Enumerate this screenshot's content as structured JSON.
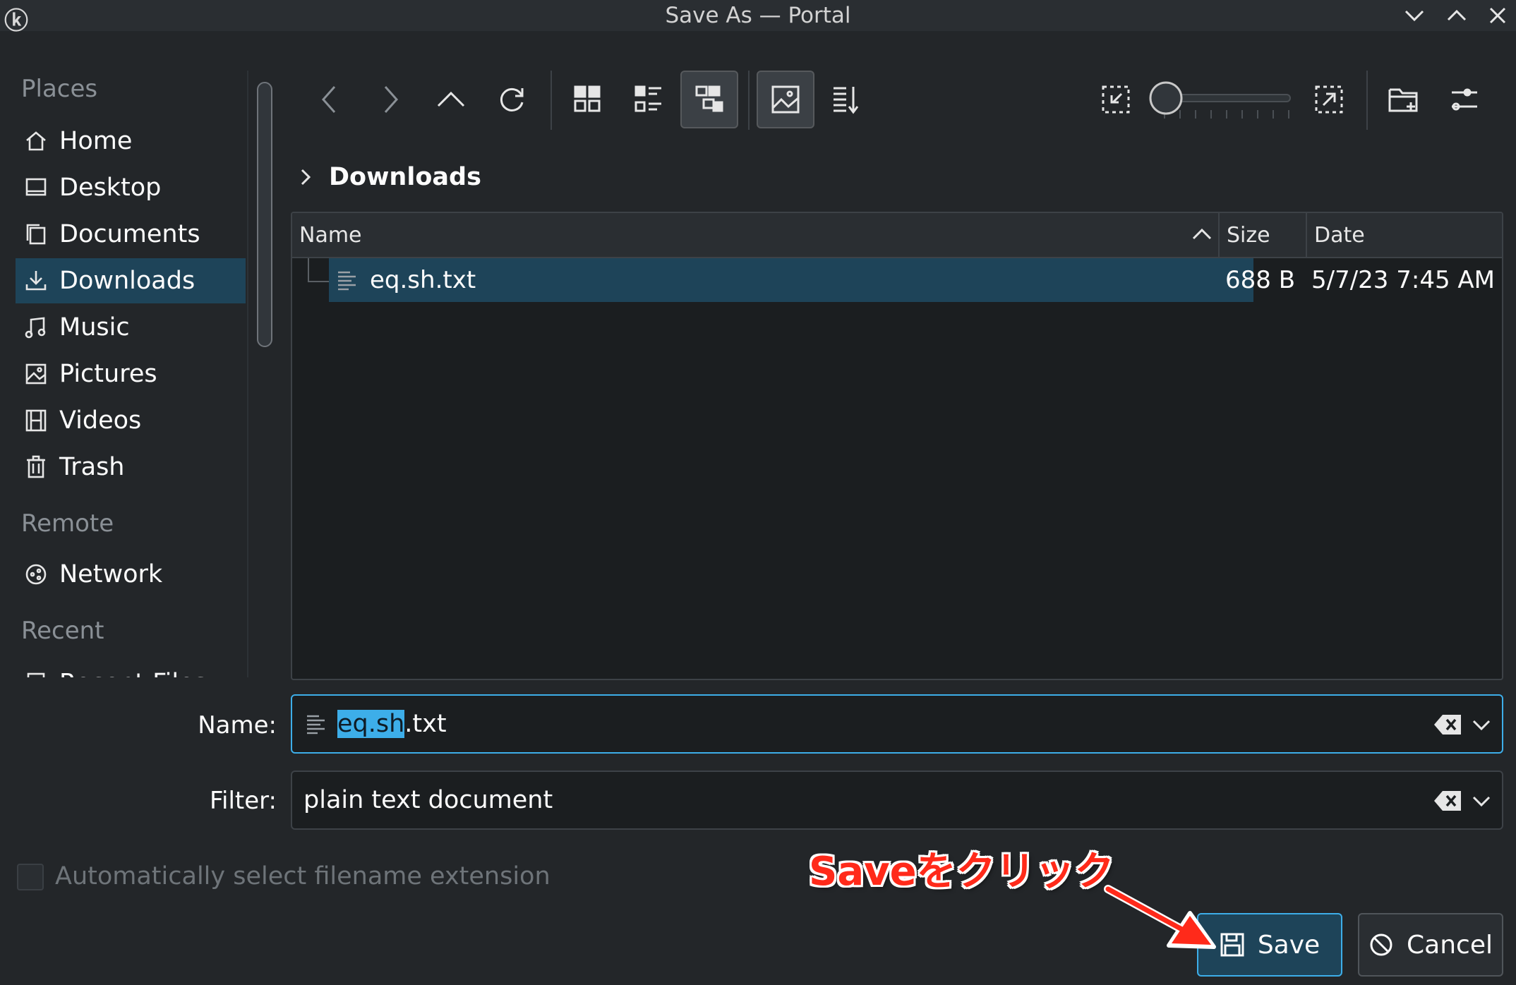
{
  "window": {
    "title": "Save As — Portal"
  },
  "sidebar": {
    "sections": [
      {
        "title": "Places"
      },
      {
        "title": "Remote"
      },
      {
        "title": "Recent"
      }
    ],
    "places": [
      {
        "label": "Home",
        "icon": "home-icon"
      },
      {
        "label": "Desktop",
        "icon": "desktop-icon"
      },
      {
        "label": "Documents",
        "icon": "documents-icon"
      },
      {
        "label": "Downloads",
        "icon": "downloads-icon",
        "selected": true
      },
      {
        "label": "Music",
        "icon": "music-icon"
      },
      {
        "label": "Pictures",
        "icon": "pictures-icon"
      },
      {
        "label": "Videos",
        "icon": "videos-icon"
      },
      {
        "label": "Trash",
        "icon": "trash-icon"
      }
    ],
    "remote": [
      {
        "label": "Network",
        "icon": "network-icon"
      }
    ],
    "recent": [
      {
        "label": "Recent Files",
        "icon": "recent-files-icon"
      }
    ]
  },
  "toolbar": {
    "icons": [
      "back-icon",
      "forward-icon",
      "up-icon",
      "reload-icon",
      "icon-view-icon",
      "compact-view-icon",
      "tree-view-icon",
      "preview-icon",
      "sort-icon",
      "zoom-out-icon",
      "zoom-in-icon",
      "new-folder-icon",
      "options-icon"
    ],
    "zoom_level": 0
  },
  "breadcrumb": {
    "current": "Downloads"
  },
  "file_table": {
    "columns": [
      "Name",
      "Size",
      "Date"
    ],
    "rows": [
      {
        "name": "eq.sh.txt",
        "size": "688 B",
        "date": "5/7/23 7:45 AM"
      }
    ]
  },
  "form": {
    "name_label": "Name:",
    "name_value_selected": "eq.sh",
    "name_value_rest": ".txt",
    "filter_label": "Filter:",
    "filter_value": "plain text document",
    "auto_ext_label": "Automatically select filename extension",
    "auto_ext_checked": false
  },
  "buttons": {
    "save": "Save",
    "cancel": "Cancel"
  },
  "annotation": {
    "text": "Saveをクリック",
    "color": "#ff2a1a"
  },
  "colors": {
    "background": "#232629",
    "selection": "#1e4459",
    "focus": "#3daee9"
  }
}
